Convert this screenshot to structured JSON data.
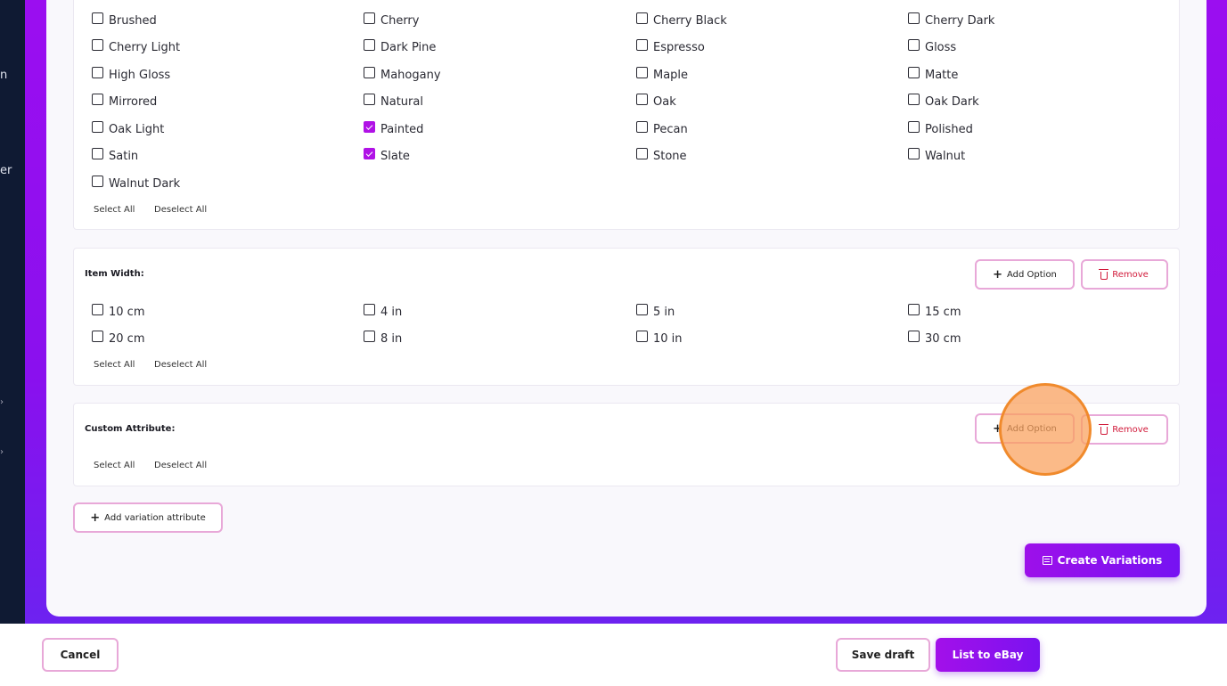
{
  "sidebar": {
    "fragments": [
      "n",
      "er"
    ]
  },
  "finish_section": {
    "options": [
      {
        "label": "Brushed",
        "checked": false
      },
      {
        "label": "Cherry",
        "checked": false
      },
      {
        "label": "Cherry Black",
        "checked": false
      },
      {
        "label": "Cherry Dark",
        "checked": false
      },
      {
        "label": "Cherry Light",
        "checked": false
      },
      {
        "label": "Dark Pine",
        "checked": false
      },
      {
        "label": "Espresso",
        "checked": false
      },
      {
        "label": "Gloss",
        "checked": false
      },
      {
        "label": "High Gloss",
        "checked": false
      },
      {
        "label": "Mahogany",
        "checked": false
      },
      {
        "label": "Maple",
        "checked": false
      },
      {
        "label": "Matte",
        "checked": false
      },
      {
        "label": "Mirrored",
        "checked": false
      },
      {
        "label": "Natural",
        "checked": false
      },
      {
        "label": "Oak",
        "checked": false
      },
      {
        "label": "Oak Dark",
        "checked": false
      },
      {
        "label": "Oak Light",
        "checked": false
      },
      {
        "label": "Painted",
        "checked": true
      },
      {
        "label": "Pecan",
        "checked": false
      },
      {
        "label": "Polished",
        "checked": false
      },
      {
        "label": "Satin",
        "checked": false
      },
      {
        "label": "Slate",
        "checked": true
      },
      {
        "label": "Stone",
        "checked": false
      },
      {
        "label": "Walnut",
        "checked": false
      },
      {
        "label": "Walnut Dark",
        "checked": false
      }
    ],
    "select_all": "Select All",
    "deselect_all": "Deselect All"
  },
  "item_width_section": {
    "title": "Item Width:",
    "add_option": "Add Option",
    "remove": "Remove",
    "options": [
      {
        "label": "10 cm",
        "checked": false
      },
      {
        "label": "4 in",
        "checked": false
      },
      {
        "label": "5 in",
        "checked": false
      },
      {
        "label": "15 cm",
        "checked": false
      },
      {
        "label": "20 cm",
        "checked": false
      },
      {
        "label": "8 in",
        "checked": false
      },
      {
        "label": "10 in",
        "checked": false
      },
      {
        "label": "30 cm",
        "checked": false
      }
    ],
    "select_all": "Select All",
    "deselect_all": "Deselect All"
  },
  "custom_section": {
    "title": "Custom Attribute:",
    "add_option": "Add Option",
    "remove": "Remove",
    "select_all": "Select All",
    "deselect_all": "Deselect All"
  },
  "add_variation_attribute": "Add variation attribute",
  "create_variations": "Create Variations",
  "footer": {
    "cancel": "Cancel",
    "save_draft": "Save draft",
    "list_to_ebay": "List to eBay"
  },
  "colors": {
    "accent": "#9d10ea",
    "checked": "#b012e6",
    "remove_red": "#d11a3a",
    "outline_pink": "#e8a8d8",
    "sidebar": "#0f1a33",
    "click_highlight": "#f08a2c"
  }
}
